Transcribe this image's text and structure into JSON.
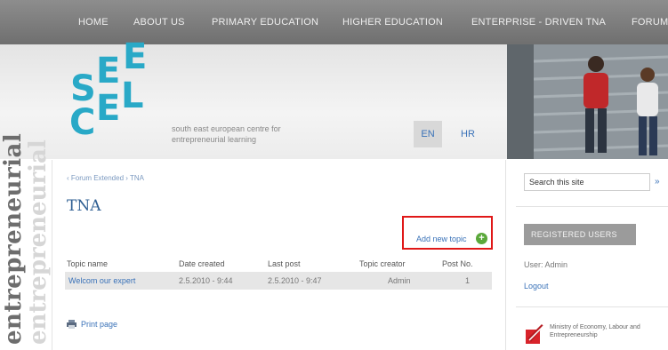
{
  "nav": {
    "items": [
      "HOME",
      "ABOUT US",
      "PRIMARY EDUCATION",
      "HIGHER EDUCATION",
      "ENTERPRISE - DRIVEN TNA",
      "FORUM"
    ]
  },
  "header": {
    "logo_text": "SEECEL",
    "tagline": "south east european centre for entrepreneurial learning",
    "lang_en": "EN",
    "lang_hr": "HR",
    "accent_color": "#29a9c7"
  },
  "side_word": "entrepreneurial",
  "main": {
    "breadcrumb": "‹ Forum Extended › TNA",
    "title": "TNA",
    "add_topic": "Add new topic",
    "add_icon": "plus-circle-icon",
    "table": {
      "headers": [
        "Topic name",
        "Date created",
        "Last post",
        "Topic creator",
        "Post No."
      ],
      "rows": [
        [
          "Welcom our expert",
          "2.5.2010 - 9:44",
          "2.5.2010 - 9:47",
          "Admin",
          "1"
        ]
      ]
    },
    "print": "Print page"
  },
  "sidebar": {
    "search_value": "Search this site",
    "search_button": "»",
    "registered_users": "REGISTERED USERS",
    "user_line": "User: Admin",
    "logout": "Logout",
    "ministry": "Ministry of Economy, Labour and Entrepreneurship"
  }
}
